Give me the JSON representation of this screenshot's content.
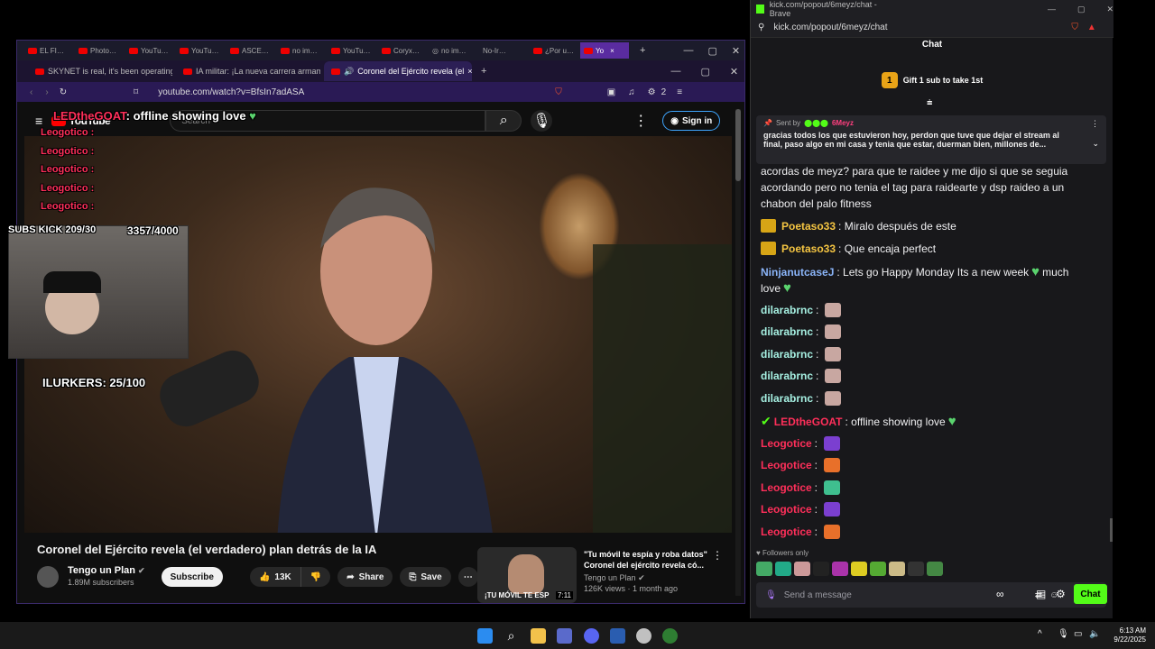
{
  "yt_browser": {
    "outer_tabs": [
      "EL FI…",
      "Photo…",
      "YouTu…",
      "YouTu…",
      "ASCE…",
      "no im…",
      "YouTu…",
      "Coryx…",
      "no im…",
      "No-Ir…",
      "¿Por u…",
      "Yo"
    ],
    "inner_tabs": [
      {
        "label": "SKYNET is real, it's been operating fo"
      },
      {
        "label": "IA militar: ¡La nueva carrera armame"
      },
      {
        "label": "Coronel del Ejército revela (el"
      }
    ],
    "url": "youtube.com/watch?v=BfsIn7adASA",
    "brave_count": "2",
    "search_placeholder": "Search",
    "sign_in": "Sign in",
    "logo": "YouTube"
  },
  "overlay": {
    "top_name": "LEDtheGOAT",
    "top_msg": ": offline showing love",
    "names": [
      "Leogotico :",
      "Leogotico :",
      "Leogotico :",
      "Leogotico :",
      "Leogotico :"
    ],
    "subs_label": "SUBS KICK 209/30",
    "subs_goal": "3357/4000",
    "lurkers": "ILURKERS: 25/100"
  },
  "video": {
    "title": "Coronel del Ejército revela (el verdadero) plan detrás de la IA",
    "channel": "Tengo un Plan",
    "subscribers": "1.89M subscribers",
    "subscribe": "Subscribe",
    "likes": "13K",
    "share": "Share",
    "save": "Save"
  },
  "related": {
    "thumb_caption": "¡TU MÓVIL TE ESP",
    "duration": "7:11",
    "title_line1": "\"Tu móvil te espía y roba datos\"",
    "title_line2": "Coronel del ejército revela có...",
    "channel": "Tengo un Plan",
    "meta": "126K views · 1 month ago"
  },
  "chat": {
    "window_title": "kick.com/popout/6meyz/chat - Brave",
    "url": "kick.com/popout/6meyz/chat",
    "header": "Chat",
    "gift_badge": "1",
    "gift_text": "Gift 1 sub to take 1st",
    "pinned_sender_prefix": "Sent by",
    "pinned_sender": "6Meyz",
    "pinned_line1": "gracias todos los que estuvieron hoy, perdon que tuve que dejar el stream al",
    "pinned_line2": "final, paso algo en mi casa y tenia que estar, duerman bien, millones de...",
    "cont_lines": [
      "acordas de meyz? para que te raidee y me dijo si que se seguia",
      "acordando pero no tenia el tag para raidearte y dsp raideo a un",
      "chabon del palo fitness"
    ],
    "messages": [
      {
        "user": "Poetaso33",
        "text": ": Miralo después de este"
      },
      {
        "user": "Poetaso33",
        "text": ": Que encaja perfect"
      },
      {
        "user": "NinjanutcaseJ",
        "text": ": Lets go Happy Monday Its a new week"
      },
      {
        "user": "",
        "text": "much"
      },
      {
        "user": "",
        "text": "love"
      },
      {
        "user": "dilarabrnc",
        "text": ":"
      },
      {
        "user": "dilarabrnc",
        "text": ":"
      },
      {
        "user": "dilarabrnc",
        "text": ":"
      },
      {
        "user": "dilarabrnc",
        "text": ":"
      },
      {
        "user": "dilarabrnc",
        "text": ":"
      },
      {
        "user": "LEDtheGOAT",
        "text": ": offline showing love"
      },
      {
        "user": "Leogotice",
        "text": ":"
      },
      {
        "user": "Leogotice",
        "text": ":"
      },
      {
        "user": "Leogotice",
        "text": ":"
      },
      {
        "user": "Leogotice",
        "text": ":"
      },
      {
        "user": "Leogotice",
        "text": ":"
      }
    ],
    "followers_only": "Followers only",
    "input_placeholder": "Send a message",
    "chat_button": "Chat"
  },
  "taskbar": {
    "time": "6:13 AM",
    "date": "9/22/2025"
  },
  "colors": {
    "kick_green": "#53fc18",
    "leogotice_red": "#ff2f5a",
    "poetaso_gold": "#f5c542",
    "dilara_teal": "#a6f0e2",
    "ninja_blue": "#8ab4f8"
  }
}
